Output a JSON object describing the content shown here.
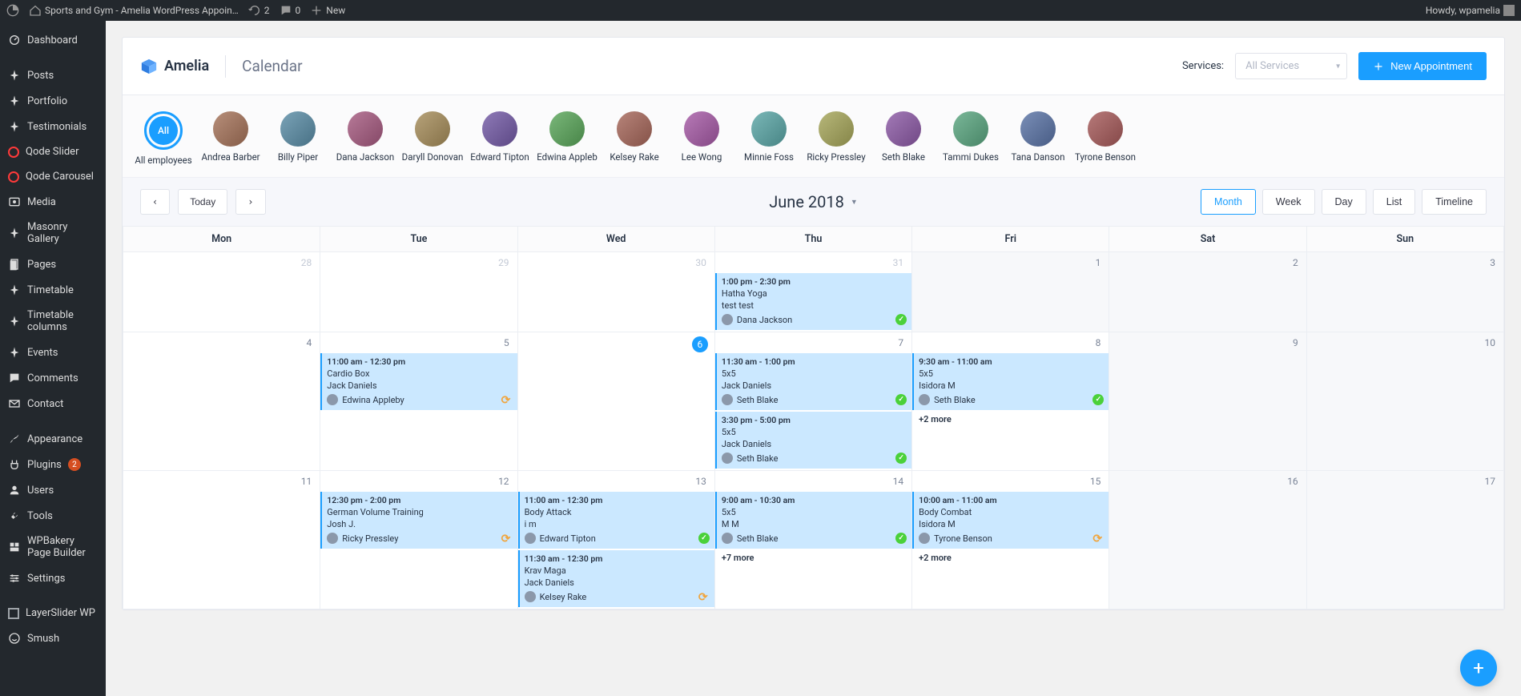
{
  "wpbar": {
    "site_title": "Sports and Gym - Amelia WordPress Appoin…",
    "refresh_count": "2",
    "comments_count": "0",
    "new_label": "New",
    "greeting": "Howdy, wpamelia"
  },
  "sidebar": {
    "items": [
      "Dashboard",
      "Posts",
      "Portfolio",
      "Testimonials",
      "Qode Slider",
      "Qode Carousel",
      "Media",
      "Masonry Gallery",
      "Pages",
      "Timetable",
      "Timetable columns",
      "Events",
      "Comments",
      "Contact",
      "Appearance",
      "Plugins",
      "Users",
      "Tools",
      "WPBakery Page Builder",
      "Settings",
      "LayerSlider WP",
      "Smush"
    ],
    "plugins_badge": "2"
  },
  "header": {
    "brand": "Amelia",
    "page_title": "Calendar",
    "services_label": "Services:",
    "services_placeholder": "All Services",
    "new_appointment": "New Appointment"
  },
  "employees": {
    "all_label_btn": "All",
    "items": [
      "All employees",
      "Andrea Barber",
      "Billy Piper",
      "Dana Jackson",
      "Daryll Donovan",
      "Edward Tipton",
      "Edwina Appleb",
      "Kelsey Rake",
      "Lee Wong",
      "Minnie Foss",
      "Ricky Pressley",
      "Seth Blake",
      "Tammi Dukes",
      "Tana Danson",
      "Tyrone Benson"
    ]
  },
  "toolbar": {
    "today": "Today",
    "title": "June 2018",
    "views": [
      "Month",
      "Week",
      "Day",
      "List",
      "Timeline"
    ],
    "active_view": "Month"
  },
  "calendar": {
    "dow": [
      "Mon",
      "Tue",
      "Wed",
      "Thu",
      "Fri",
      "Sat",
      "Sun"
    ],
    "weeks": [
      [
        {
          "num": "28",
          "muted": true
        },
        {
          "num": "29",
          "muted": true
        },
        {
          "num": "30",
          "muted": true
        },
        {
          "num": "31",
          "muted": true,
          "events": [
            {
              "time": "1:00 pm - 2:30 pm",
              "name": "Hatha Yoga",
              "cust": "test test",
              "emp": "Dana Jackson",
              "stat": "approved"
            }
          ]
        },
        {
          "num": "1",
          "blank": true
        },
        {
          "num": "2",
          "blank": true
        },
        {
          "num": "3",
          "blank": true
        }
      ],
      [
        {
          "num": "4"
        },
        {
          "num": "5",
          "events": [
            {
              "time": "11:00 am - 12:30 pm",
              "name": "Cardio Box",
              "cust": "Jack Daniels",
              "emp": "Edwina Appleby",
              "stat": "pending"
            }
          ]
        },
        {
          "num": "6",
          "today": true
        },
        {
          "num": "7",
          "events": [
            {
              "time": "11:30 am - 1:00 pm",
              "name": "5x5",
              "cust": "Jack Daniels",
              "emp": "Seth Blake",
              "stat": "approved"
            },
            {
              "time": "3:30 pm - 5:00 pm",
              "name": "5x5",
              "cust": "Jack Daniels",
              "emp": "Seth Blake",
              "stat": "approved"
            }
          ]
        },
        {
          "num": "8",
          "events": [
            {
              "time": "9:30 am - 11:00 am",
              "name": "5x5",
              "cust": "Isidora M",
              "emp": "Seth Blake",
              "stat": "approved"
            }
          ],
          "more": "+2 more"
        },
        {
          "num": "9",
          "blank": true
        },
        {
          "num": "10",
          "blank": true
        }
      ],
      [
        {
          "num": "11"
        },
        {
          "num": "12",
          "events": [
            {
              "time": "12:30 pm - 2:00 pm",
              "name": "German Volume Training",
              "cust": "Josh J.",
              "emp": "Ricky Pressley",
              "stat": "pending"
            }
          ]
        },
        {
          "num": "13",
          "events": [
            {
              "time": "11:00 am - 12:30 pm",
              "name": "Body Attack",
              "cust": "i m",
              "emp": "Edward Tipton",
              "stat": "approved"
            },
            {
              "time": "11:30 am - 12:30 pm",
              "name": "Krav Maga",
              "cust": "Jack Daniels",
              "emp": "Kelsey Rake",
              "stat": "pending"
            }
          ]
        },
        {
          "num": "14",
          "events": [
            {
              "time": "9:00 am - 10:30 am",
              "name": "5x5",
              "cust": "M M",
              "emp": "Seth Blake",
              "stat": "approved"
            }
          ],
          "more": "+7 more"
        },
        {
          "num": "15",
          "events": [
            {
              "time": "10:00 am - 11:00 am",
              "name": "Body Combat",
              "cust": "Isidora M",
              "emp": "Tyrone Benson",
              "stat": "pending"
            }
          ],
          "more": "+2 more"
        },
        {
          "num": "16",
          "blank": true
        },
        {
          "num": "17",
          "blank": true
        }
      ]
    ]
  },
  "fab_label": "+"
}
